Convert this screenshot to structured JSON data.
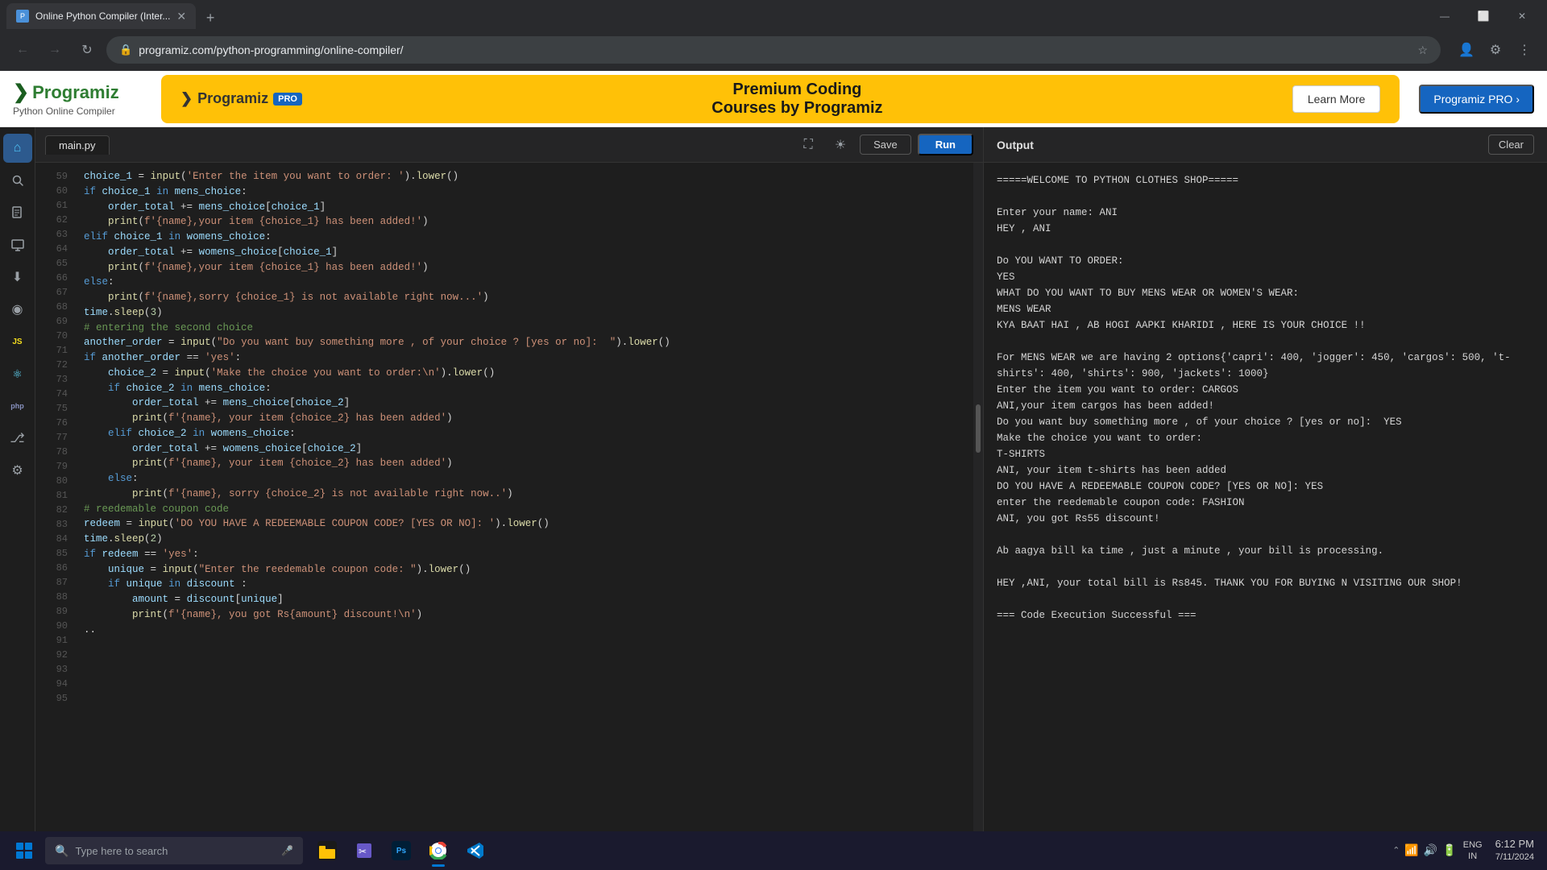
{
  "browser": {
    "tab_title": "Online Python Compiler (Inter...",
    "url": "programiz.com/python-programming/online-compiler/",
    "window_controls": {
      "minimize": "—",
      "maximize": "⬜",
      "close": "✕"
    }
  },
  "header": {
    "logo": "Programiz",
    "subtitle": "Python Online Compiler",
    "banner": {
      "logo_text": "Programiz",
      "logo_pro": "PRO",
      "title_line1": "Premium Coding",
      "title_line2": "Courses by Programiz",
      "learn_more_label": "Learn More"
    },
    "pro_button": "Programiz PRO ›"
  },
  "editor": {
    "filename": "main.py",
    "save_label": "Save",
    "run_label": "Run",
    "lines": [
      {
        "num": "59",
        "code": ""
      },
      {
        "num": "60",
        "code": "choice_1 = input('Enter the item you want to order: ').lower()"
      },
      {
        "num": "61",
        "code": "if choice_1 in mens_choice:"
      },
      {
        "num": "62",
        "code": "    order_total += mens_choice[choice_1]"
      },
      {
        "num": "63",
        "code": "    print(f'{name},your item {choice_1} has been added!')"
      },
      {
        "num": "64",
        "code": "elif choice_1 in womens_choice:"
      },
      {
        "num": "65",
        "code": "    order_total += womens_choice[choice_1]"
      },
      {
        "num": "66",
        "code": "    print(f'{name},your item {choice_1} has been added!')"
      },
      {
        "num": "67",
        "code": "else:"
      },
      {
        "num": "68",
        "code": "    print(f'{name},sorry {choice_1} is not available right now...')"
      },
      {
        "num": "69",
        "code": ""
      },
      {
        "num": "70",
        "code": "time.sleep(3)"
      },
      {
        "num": "71",
        "code": ""
      },
      {
        "num": "72",
        "code": "# entering the second choice"
      },
      {
        "num": "73",
        "code": ""
      },
      {
        "num": "74",
        "code": "another_order = input(\"Do you want buy something more , of your choice ? [yes or no]:  \").lower()"
      },
      {
        "num": "75",
        "code": ""
      },
      {
        "num": "76",
        "code": "if another_order == 'yes':"
      },
      {
        "num": "77",
        "code": "    choice_2 = input('Make the choice you want to order:\\n').lower()"
      },
      {
        "num": "78",
        "code": "    if choice_2 in mens_choice:"
      },
      {
        "num": "79",
        "code": "        order_total += mens_choice[choice_2]"
      },
      {
        "num": "80",
        "code": "        print(f'{name}, your item {choice_2} has been added')"
      },
      {
        "num": "81",
        "code": "    elif choice_2 in womens_choice:"
      },
      {
        "num": "82",
        "code": "        order_total += womens_choice[choice_2]"
      },
      {
        "num": "83",
        "code": "        print(f'{name}, your item {choice_2} has been added')"
      },
      {
        "num": "84",
        "code": "    else:"
      },
      {
        "num": "85",
        "code": "        print(f'{name}, sorry {choice_2} is not available right now..')"
      },
      {
        "num": "86",
        "code": ""
      },
      {
        "num": "87",
        "code": "# reedemable coupon code"
      },
      {
        "num": "88",
        "code": "redeem = input('DO YOU HAVE A REDEEMABLE COUPON CODE? [YES OR NO]: ').lower()"
      },
      {
        "num": "89",
        "code": "time.sleep(2)"
      },
      {
        "num": "90",
        "code": "if redeem == 'yes':"
      },
      {
        "num": "91",
        "code": "    unique = input(\"Enter the reedemable coupon code: \").lower()"
      },
      {
        "num": "92",
        "code": "    if unique in discount :"
      },
      {
        "num": "93",
        "code": "        amount = discount[unique]"
      },
      {
        "num": "94",
        "code": "        print(f'{name}, you got Rs{amount} discount!\\n')"
      },
      {
        "num": "95",
        "code": ".."
      }
    ]
  },
  "output": {
    "title": "Output",
    "clear_label": "Clear",
    "content": "=====WELCOME TO PYTHON CLOTHES SHOP=====\n\nEnter your name: ANI\nHEY , ANI\n\nDo YOU WANT TO ORDER:\nYES\nWHAT DO YOU WANT TO BUY MENS WEAR OR WOMEN'S WEAR:\nMENS WEAR\nKYA BAAT HAI , AB HOGI AAPKI KHARIDI , HERE IS YOUR CHOICE !!\n\nFor MENS WEAR we are having 2 options{'capri': 400, 'jogger': 450, 'cargos': 500, 't-shirts': 400, 'shirts': 900, 'jackets': 1000}\nEnter the item you want to order: CARGOS\nANI,your item cargos has been added!\nDo you want buy something more , of your choice ? [yes or no]:  YES\nMake the choice you want to order:\nT-SHIRTS\nANI, your item t-shirts has been added\nDO YOU HAVE A REDEEMABLE COUPON CODE? [YES OR NO]: YES\nenter the reedemable coupon code: FASHION\nANI, you got Rs55 discount!\n\nAb aagya bill ka time , just a minute , your bill is processing.\n\nHEY ,ANI, your total bill is Rs845. THANK YOU FOR BUYING N VISITING OUR SHOP!\n\n=== Code Execution Successful ==="
  },
  "sidebar": {
    "icons": [
      {
        "name": "home-icon",
        "symbol": "⌂",
        "active": true
      },
      {
        "name": "search-icon",
        "symbol": "🔍",
        "active": false
      },
      {
        "name": "file-icon",
        "symbol": "📄",
        "active": false
      },
      {
        "name": "tutorial-icon",
        "symbol": "📚",
        "active": false
      },
      {
        "name": "download-icon",
        "symbol": "⬇",
        "active": false
      },
      {
        "name": "circle-icon",
        "symbol": "◉",
        "active": false
      },
      {
        "name": "js-icon",
        "symbol": "JS",
        "active": false
      },
      {
        "name": "react-icon",
        "symbol": "⚛",
        "active": false
      },
      {
        "name": "php-icon",
        "symbol": "php",
        "active": false
      },
      {
        "name": "git-icon",
        "symbol": "⎇",
        "active": false
      },
      {
        "name": "settings-icon",
        "symbol": "⚙",
        "active": false
      }
    ]
  },
  "taskbar": {
    "search_placeholder": "Type here to search",
    "apps": [
      {
        "name": "file-explorer-icon",
        "color": "#ffc107",
        "symbol": "📁"
      },
      {
        "name": "snipping-tool-icon",
        "color": "#7b68ee",
        "symbol": "✂"
      },
      {
        "name": "photoshop-icon",
        "color": "#001e36",
        "symbol": "Ps"
      },
      {
        "name": "chrome-icon",
        "color": "#4285f4",
        "symbol": "●"
      },
      {
        "name": "vscode-icon",
        "color": "#007acc",
        "symbol": "⌨"
      }
    ],
    "system_tray": {
      "time": "6:12 PM",
      "date": "7/11/2024",
      "language": "ENG\nIN"
    }
  }
}
